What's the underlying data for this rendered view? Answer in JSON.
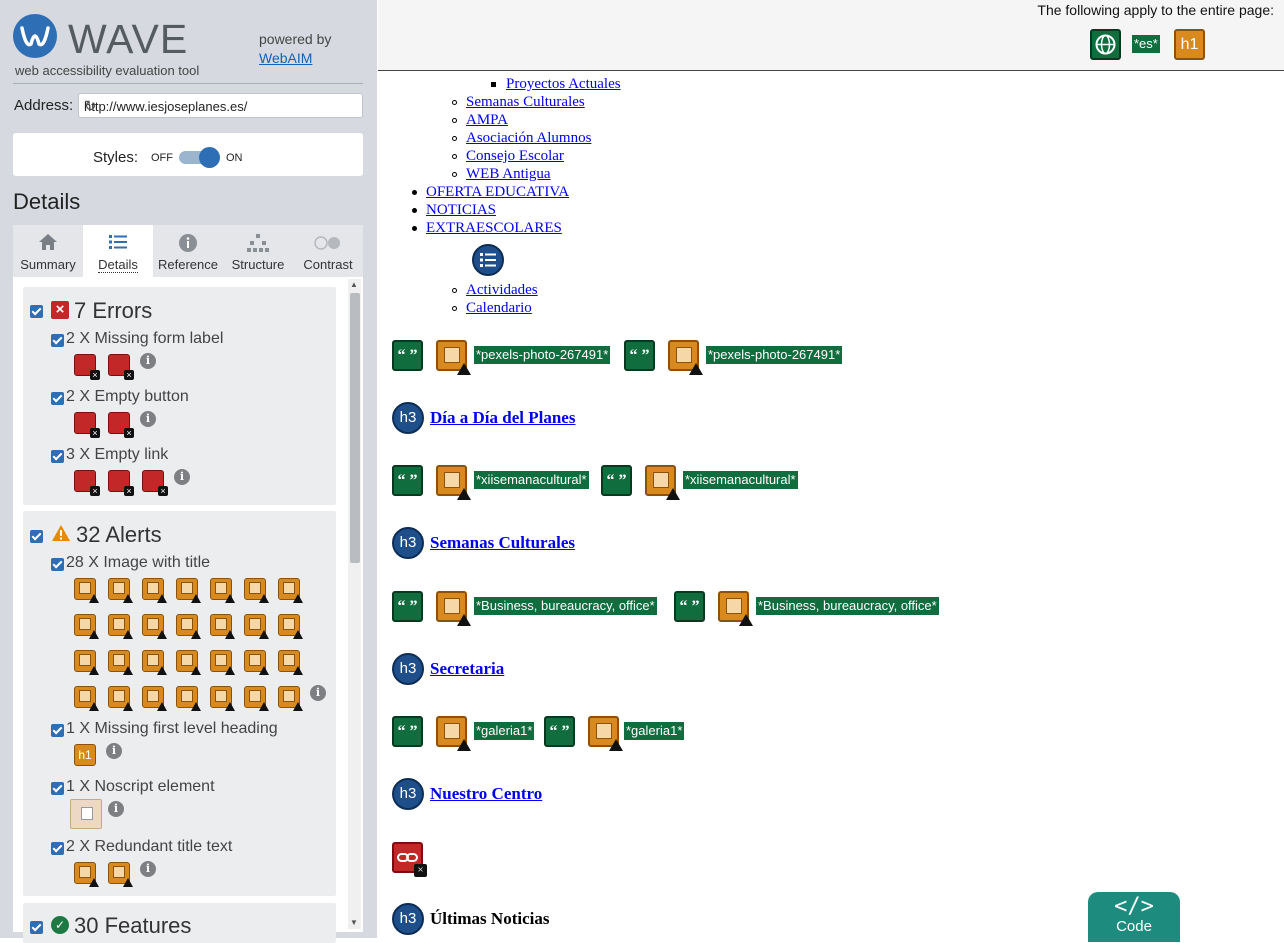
{
  "sidebar": {
    "logo_word": "WAVE",
    "tagline": "web accessibility evaluation tool",
    "powered_by": "powered by",
    "powered_link": "WebAIM",
    "address_label": "Address:",
    "address_value": "http://www.iesjoseplanes.es/",
    "styles_label": "Styles:",
    "styles_off": "OFF",
    "styles_on": "ON",
    "details_heading": "Details",
    "tabs": [
      {
        "label": "Summary",
        "icon": "home-icon"
      },
      {
        "label": "Details",
        "icon": "list-icon"
      },
      {
        "label": "Reference",
        "icon": "info-icon"
      },
      {
        "label": "Structure",
        "icon": "structure-icon"
      },
      {
        "label": "Contrast",
        "icon": "contrast-icon"
      }
    ],
    "errors": {
      "title": "7 Errors",
      "items": [
        {
          "label": "2 X Missing form label"
        },
        {
          "label": "2 X Empty button"
        },
        {
          "label": "3 X Empty link"
        }
      ]
    },
    "alerts": {
      "title": "32 Alerts",
      "items": [
        {
          "label": "28 X Image with title"
        },
        {
          "label": "1 X Missing first level heading"
        },
        {
          "label": "1 X Noscript element"
        },
        {
          "label": "2 X Redundant title text"
        }
      ]
    },
    "features": {
      "title": "30 Features"
    }
  },
  "topbar": {
    "text": "The following apply to the entire page:",
    "lang_badge": "*es*",
    "h1_badge": "h1"
  },
  "page": {
    "nav": {
      "proyectos_actuales": "Proyectos Actuales",
      "semanas_culturales": "Semanas Culturales",
      "ampa": "AMPA",
      "asociacion_alumnos": "Asociación Alumnos",
      "consejo_escolar": "Consejo Escolar",
      "web_antigua": "WEB Antigua",
      "oferta_educativa": "OFERTA EDUCATIVA",
      "noticias": "NOTICIAS",
      "extraescolares": "EXTRAESCOLARES",
      "actividades": "Actividades",
      "calendario": "Calendario"
    },
    "alt_labels": {
      "row1": "*pexels-photo-267491*",
      "row2": "*xiisemanacultural*",
      "row3": "*Business, bureaucracy, office*",
      "row4": "*galeria1*"
    },
    "headings": {
      "h3_icon": "h3",
      "dia_a_dia": "Día a Día del Planes",
      "semanas": "Semanas Culturales",
      "secretaria": "Secretaria",
      "nuestro_centro": "Nuestro Centro",
      "ultimas": "Últimas Noticias"
    },
    "quote_glyph": "“ ”"
  },
  "code_button": {
    "label": "Code",
    "glyph": "</>"
  },
  "colors": {
    "error": "#c42727",
    "alert": "#d98a1e",
    "feature": "#0f6d3e",
    "structure": "#1e4f8a",
    "brand": "#2d6eb4"
  }
}
